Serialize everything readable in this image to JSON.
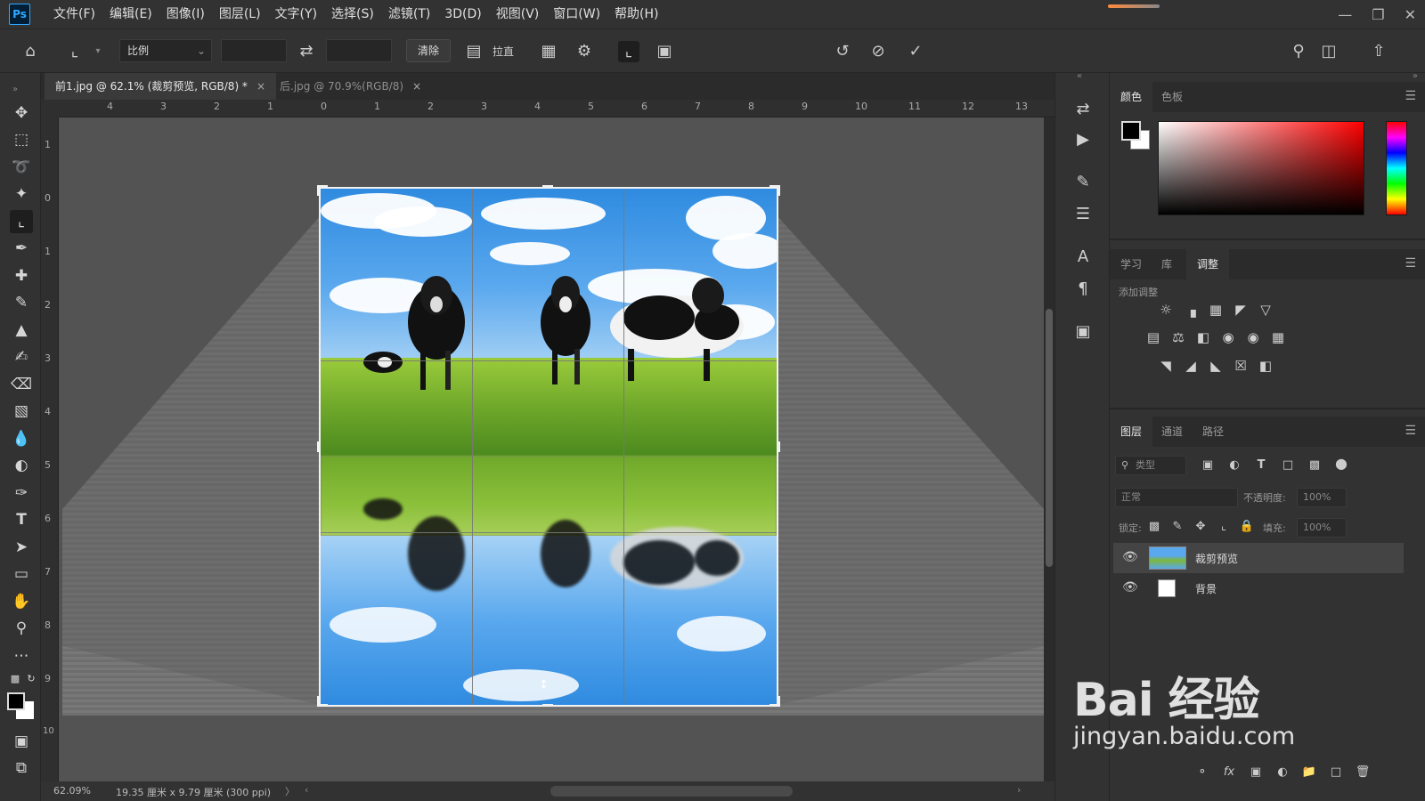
{
  "app": {
    "logo": "Ps"
  },
  "menu": [
    "文件(F)",
    "编辑(E)",
    "图像(I)",
    "图层(L)",
    "文字(Y)",
    "选择(S)",
    "滤镜(T)",
    "3D(D)",
    "视图(V)",
    "窗口(W)",
    "帮助(H)"
  ],
  "options": {
    "ratio_label": "比例",
    "clear_label": "清除",
    "straighten_label": "拉直"
  },
  "tabs": [
    {
      "label": "前1.jpg @ 62.1% (裁剪预览, RGB/8) *",
      "close": "×"
    },
    {
      "label": "后.jpg @ 70.9%(RGB/8)",
      "close": "×"
    }
  ],
  "ruler_top": [
    "4",
    "3",
    "2",
    "1",
    "0",
    "1",
    "2",
    "3",
    "4",
    "5",
    "6",
    "7",
    "8",
    "9",
    "10",
    "11",
    "12",
    "13"
  ],
  "ruler_left": [
    "1",
    "0",
    "1",
    "2",
    "3",
    "4",
    "5",
    "6",
    "7",
    "8",
    "9",
    "10"
  ],
  "status": {
    "zoom": "62.09%",
    "doc_info": "19.35 厘米 x 9.79 厘米 (300 ppi)",
    "arrow": "〉"
  },
  "panels": {
    "color": {
      "tabs": [
        "颜色",
        "色板"
      ],
      "fg_color": "#000000",
      "bg_color": "#ffffff"
    },
    "adjust": {
      "tabs": [
        "学习",
        "库",
        "调整"
      ],
      "heading": "添加调整"
    },
    "layers": {
      "tabs": [
        "图层",
        "通道",
        "路径"
      ],
      "filter_placeholder": "类型",
      "blend_mode": "正常",
      "opacity_label": "不透明度:",
      "opacity_value": "100%",
      "lock_label": "锁定:",
      "fill_label": "填充:",
      "fill_value": "100%",
      "items": [
        {
          "name": "裁剪预览",
          "visible": true,
          "selected": true
        },
        {
          "name": "背景",
          "visible": true,
          "selected": false
        }
      ]
    }
  },
  "watermark": {
    "main": "Bai 经验",
    "sub": "jingyan.baidu.com"
  }
}
